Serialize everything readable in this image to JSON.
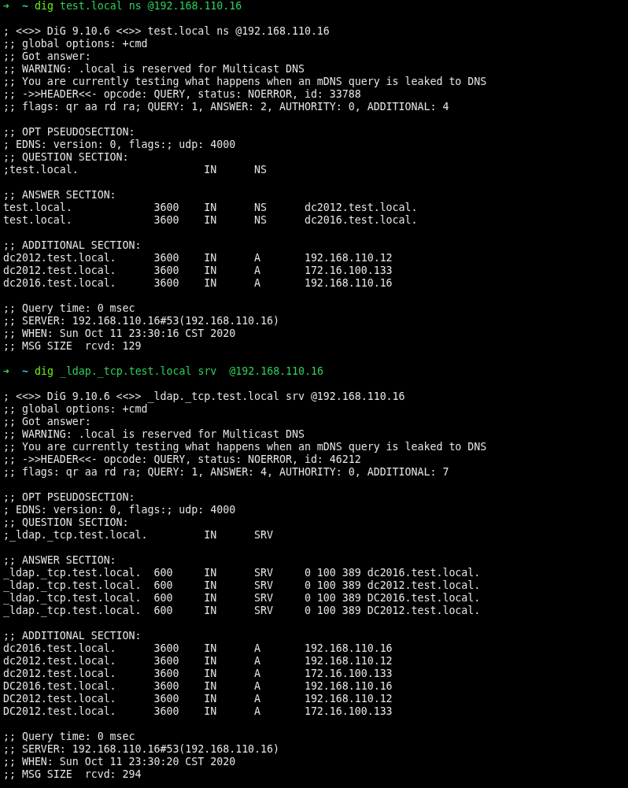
{
  "terminal": {
    "lines": [
      {
        "kind": "prompt",
        "arrow": "➜",
        "directory": "~",
        "command": "dig",
        "arguments": "test.local ns @192.168.110.16"
      },
      {
        "kind": "blank"
      },
      {
        "kind": "output",
        "text": "; <<>> DiG 9.10.6 <<>> test.local ns @192.168.110.16"
      },
      {
        "kind": "output",
        "text": ";; global options: +cmd"
      },
      {
        "kind": "output",
        "text": ";; Got answer:"
      },
      {
        "kind": "output",
        "text": ";; WARNING: .local is reserved for Multicast DNS"
      },
      {
        "kind": "output",
        "text": ";; You are currently testing what happens when an mDNS query is leaked to DNS"
      },
      {
        "kind": "output",
        "text": ";; ->>HEADER<<- opcode: QUERY, status: NOERROR, id: 33788"
      },
      {
        "kind": "output",
        "text": ";; flags: qr aa rd ra; QUERY: 1, ANSWER: 2, AUTHORITY: 0, ADDITIONAL: 4"
      },
      {
        "kind": "blank"
      },
      {
        "kind": "output",
        "text": ";; OPT PSEUDOSECTION:"
      },
      {
        "kind": "output",
        "text": "; EDNS: version: 0, flags:; udp: 4000"
      },
      {
        "kind": "output",
        "text": ";; QUESTION SECTION:"
      },
      {
        "kind": "output",
        "text": ";test.local.                    IN      NS"
      },
      {
        "kind": "blank"
      },
      {
        "kind": "output",
        "text": ";; ANSWER SECTION:"
      },
      {
        "kind": "output",
        "text": "test.local.             3600    IN      NS      dc2012.test.local."
      },
      {
        "kind": "output",
        "text": "test.local.             3600    IN      NS      dc2016.test.local."
      },
      {
        "kind": "blank"
      },
      {
        "kind": "output",
        "text": ";; ADDITIONAL SECTION:"
      },
      {
        "kind": "output",
        "text": "dc2012.test.local.      3600    IN      A       192.168.110.12"
      },
      {
        "kind": "output",
        "text": "dc2012.test.local.      3600    IN      A       172.16.100.133"
      },
      {
        "kind": "output",
        "text": "dc2016.test.local.      3600    IN      A       192.168.110.16"
      },
      {
        "kind": "blank"
      },
      {
        "kind": "output",
        "text": ";; Query time: 0 msec"
      },
      {
        "kind": "output",
        "text": ";; SERVER: 192.168.110.16#53(192.168.110.16)"
      },
      {
        "kind": "output",
        "text": ";; WHEN: Sun Oct 11 23:30:16 CST 2020"
      },
      {
        "kind": "output",
        "text": ";; MSG SIZE  rcvd: 129"
      },
      {
        "kind": "blank"
      },
      {
        "kind": "prompt",
        "arrow": "➜",
        "directory": "~",
        "command": "dig",
        "arguments": "_ldap._tcp.test.local srv  @192.168.110.16"
      },
      {
        "kind": "blank"
      },
      {
        "kind": "output",
        "text": "; <<>> DiG 9.10.6 <<>> _ldap._tcp.test.local srv @192.168.110.16"
      },
      {
        "kind": "output",
        "text": ";; global options: +cmd"
      },
      {
        "kind": "output",
        "text": ";; Got answer:"
      },
      {
        "kind": "output",
        "text": ";; WARNING: .local is reserved for Multicast DNS"
      },
      {
        "kind": "output",
        "text": ";; You are currently testing what happens when an mDNS query is leaked to DNS"
      },
      {
        "kind": "output",
        "text": ";; ->>HEADER<<- opcode: QUERY, status: NOERROR, id: 46212"
      },
      {
        "kind": "output",
        "text": ";; flags: qr aa rd ra; QUERY: 1, ANSWER: 4, AUTHORITY: 0, ADDITIONAL: 7"
      },
      {
        "kind": "blank"
      },
      {
        "kind": "output",
        "text": ";; OPT PSEUDOSECTION:"
      },
      {
        "kind": "output",
        "text": "; EDNS: version: 0, flags:; udp: 4000"
      },
      {
        "kind": "output",
        "text": ";; QUESTION SECTION:"
      },
      {
        "kind": "output",
        "text": ";_ldap._tcp.test.local.         IN      SRV"
      },
      {
        "kind": "blank"
      },
      {
        "kind": "output",
        "text": ";; ANSWER SECTION:"
      },
      {
        "kind": "output",
        "text": "_ldap._tcp.test.local.  600     IN      SRV     0 100 389 dc2016.test.local."
      },
      {
        "kind": "output",
        "text": "_ldap._tcp.test.local.  600     IN      SRV     0 100 389 dc2012.test.local."
      },
      {
        "kind": "output",
        "text": "_ldap._tcp.test.local.  600     IN      SRV     0 100 389 DC2016.test.local."
      },
      {
        "kind": "output",
        "text": "_ldap._tcp.test.local.  600     IN      SRV     0 100 389 DC2012.test.local."
      },
      {
        "kind": "blank"
      },
      {
        "kind": "output",
        "text": ";; ADDITIONAL SECTION:"
      },
      {
        "kind": "output",
        "text": "dc2016.test.local.      3600    IN      A       192.168.110.16"
      },
      {
        "kind": "output",
        "text": "dc2012.test.local.      3600    IN      A       192.168.110.12"
      },
      {
        "kind": "output",
        "text": "dc2012.test.local.      3600    IN      A       172.16.100.133"
      },
      {
        "kind": "output",
        "text": "DC2016.test.local.      3600    IN      A       192.168.110.16"
      },
      {
        "kind": "output",
        "text": "DC2012.test.local.      3600    IN      A       192.168.110.12"
      },
      {
        "kind": "output",
        "text": "DC2012.test.local.      3600    IN      A       172.16.100.133"
      },
      {
        "kind": "blank"
      },
      {
        "kind": "output",
        "text": ";; Query time: 0 msec"
      },
      {
        "kind": "output",
        "text": ";; SERVER: 192.168.110.16#53(192.168.110.16)"
      },
      {
        "kind": "output",
        "text": ";; WHEN: Sun Oct 11 23:30:20 CST 2020"
      },
      {
        "kind": "output",
        "text": ";; MSG SIZE  rcvd: 294"
      }
    ]
  }
}
